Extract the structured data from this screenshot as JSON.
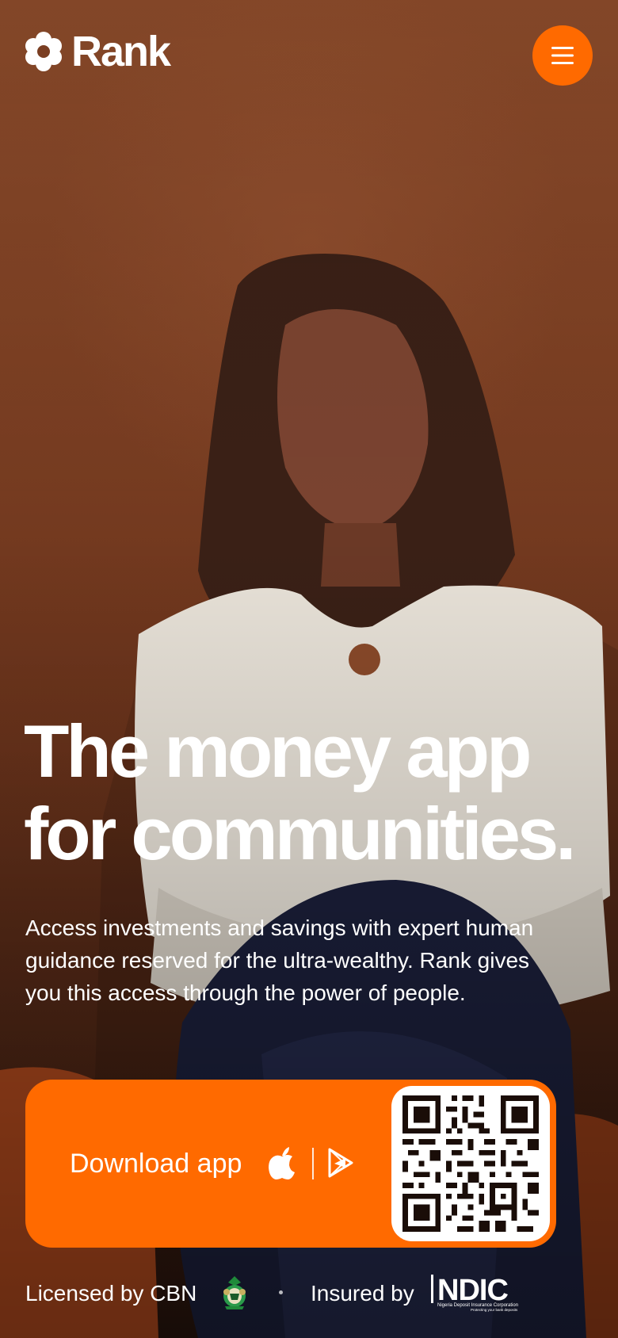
{
  "brand": {
    "name": "Rank",
    "logo_icon": "flower-logo-icon",
    "accent_color": "#ff6a00"
  },
  "header": {
    "menu_icon": "hamburger-menu-icon"
  },
  "hero": {
    "headline_line1": "The money app",
    "headline_line2": "for communities.",
    "description": "Access investments and savings with expert human guidance reserved for the ultra-wealthy. Rank gives you this access through the power of people."
  },
  "download": {
    "label": "Download app",
    "store_icons": [
      "apple-icon",
      "google-play-icon"
    ],
    "qr_icon": "qr-code-icon"
  },
  "footer": {
    "licensed_text": "Licensed by CBN",
    "insured_text": "Insured by",
    "ndic_wordmark": "NDIC",
    "ndic_caption": "Nigeria Deposit Insurance Corporation",
    "ndic_tagline": "Protecting your bank deposits"
  }
}
